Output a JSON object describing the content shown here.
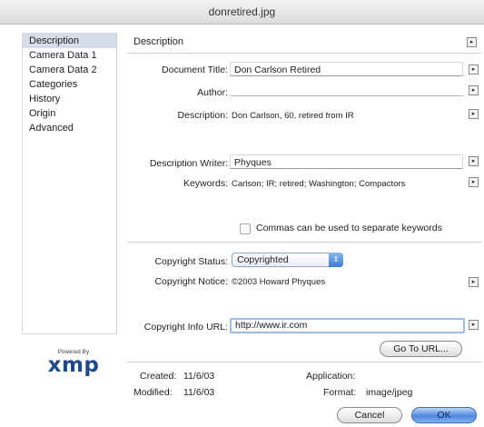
{
  "window": {
    "title": "donretired.jpg"
  },
  "sidebar": {
    "items": [
      {
        "label": "Description"
      },
      {
        "label": "Camera Data 1"
      },
      {
        "label": "Camera Data 2"
      },
      {
        "label": "Categories"
      },
      {
        "label": "History"
      },
      {
        "label": "Origin"
      },
      {
        "label": "Advanced"
      }
    ],
    "selected": "Description"
  },
  "logo": {
    "line1": "Powered By",
    "line2": "xmp"
  },
  "panel": {
    "title": "Description"
  },
  "fields": {
    "document_title": {
      "label": "Document Title:",
      "value": "Don Carlson Retired"
    },
    "author": {
      "label": "Author:",
      "value": ""
    },
    "description": {
      "label": "Description:",
      "value": "Don Carlson, 60, retired from IR"
    },
    "description_writer": {
      "label": "Description Writer:",
      "value": "Phyques"
    },
    "keywords": {
      "label": "Keywords:",
      "value": "Carlson; IR; retired; Washington; Compactors"
    },
    "keywords_hint": "Commas can be used to separate keywords",
    "copyright_status": {
      "label": "Copyright Status:",
      "value": "Copyrighted"
    },
    "copyright_notice": {
      "label": "Copyright Notice:",
      "value": "©2003 Howard Phyques"
    },
    "copyright_url": {
      "label": "Copyright Info URL:",
      "value": "http://www.ir.com"
    }
  },
  "buttons": {
    "goto_url": "Go To URL...",
    "cancel": "Cancel",
    "ok": "OK"
  },
  "footer": {
    "created_label": "Created:",
    "created_value": "11/6/03",
    "modified_label": "Modified:",
    "modified_value": "11/6/03",
    "application_label": "Application:",
    "application_value": "",
    "format_label": "Format:",
    "format_value": "image/jpeg"
  },
  "colors": {
    "selection": "#d6dde8",
    "accent": "#4f8ae0",
    "logo": "#1c4a88"
  },
  "icons": {
    "field_menu": "triangle-right-icon",
    "popup": "up-down-arrows-icon"
  }
}
